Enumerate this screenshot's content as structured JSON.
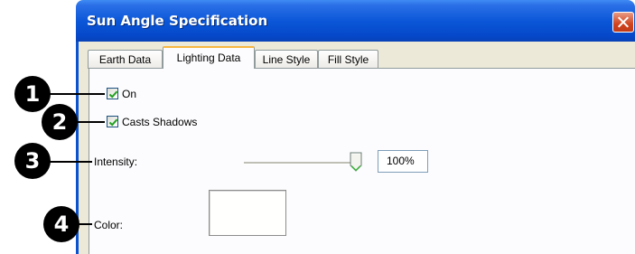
{
  "window": {
    "title": "Sun Angle Specification",
    "close_icon": "close-icon"
  },
  "tabs": [
    {
      "label": "Earth Data",
      "active": false
    },
    {
      "label": "Lighting Data",
      "active": true
    },
    {
      "label": "Line Style",
      "active": false
    },
    {
      "label": "Fill Style",
      "active": false
    }
  ],
  "lighting": {
    "on": {
      "label": "On",
      "checked": true
    },
    "casts_shadows": {
      "label": "Casts Shadows",
      "checked": true
    },
    "intensity": {
      "label": "Intensity:",
      "value": "100%",
      "slider_fraction": 1.0
    },
    "color": {
      "label": "Color:",
      "value": "#fffffd"
    }
  },
  "callouts": [
    "1",
    "2",
    "3",
    "4"
  ],
  "colors": {
    "title_bar": "#0a56d8",
    "close_button": "#d0441f",
    "dialog_face": "#ece9d8",
    "active_tab_accent": "#f7b742",
    "check_mark": "#21a121"
  }
}
